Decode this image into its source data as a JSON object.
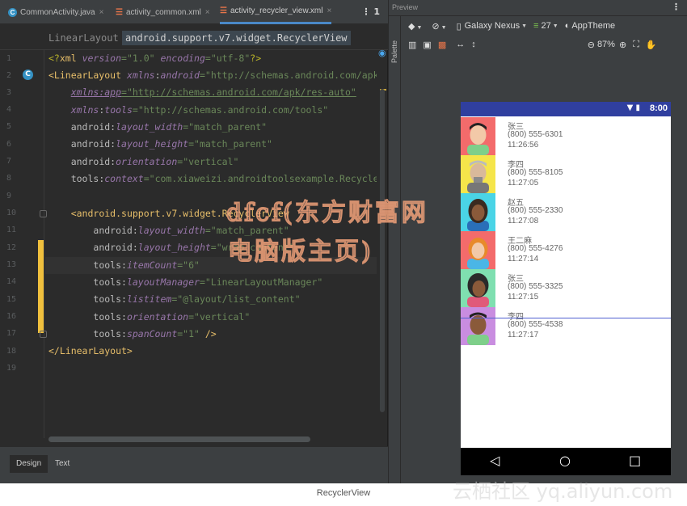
{
  "tabs": [
    {
      "label": "CommonActivity.java",
      "type": "java",
      "icon": "java-class-icon"
    },
    {
      "label": "activity_common.xml",
      "type": "xml",
      "icon": "layout-xml-icon"
    },
    {
      "label": "activity_recycler_view.xml",
      "type": "xml",
      "icon": "layout-xml-icon",
      "active": true
    }
  ],
  "tab_close_glyph": "×",
  "tab_menu_glyph": "⋮ 1",
  "breadcrumb": [
    "LinearLayout",
    "android.support.v7.widget.RecyclerView"
  ],
  "code": {
    "line_numbers": [
      "1",
      "2",
      "3",
      "4",
      "5",
      "6",
      "7",
      "8",
      "9",
      "10",
      "11",
      "12",
      "13",
      "14",
      "15",
      "16",
      "17",
      "18",
      "19"
    ]
  },
  "bottom_tabs": [
    "Design",
    "Text"
  ],
  "preview": {
    "title": "Preview",
    "palette_label": "Palette",
    "device": "Galaxy Nexus",
    "api": "27",
    "theme": "AppTheme",
    "zoom": "87%",
    "status_time": "8:00",
    "items": [
      {
        "name": "张三",
        "phone": "(800) 555-6301",
        "time": "11:26:56",
        "bg": "#f36b6b"
      },
      {
        "name": "李四",
        "phone": "(800) 555-8105",
        "time": "11:27:05",
        "bg": "#f5e54a"
      },
      {
        "name": "赵五",
        "phone": "(800) 555-2330",
        "time": "11:27:08",
        "bg": "#4ad4e6"
      },
      {
        "name": "王二麻",
        "phone": "(800) 555-4276",
        "time": "11:27:14",
        "bg": "#f36b6b"
      },
      {
        "name": "张三",
        "phone": "(800) 555-3325",
        "time": "11:27:15",
        "bg": "#7fdfb0"
      },
      {
        "name": "李四",
        "phone": "(800) 555-4538",
        "time": "11:27:17",
        "bg": "#c98de0"
      }
    ]
  },
  "watermark": {
    "line1": "dfcf(东方财富网",
    "line2": "电脑版主页)",
    "site": "云栖社区 yq.aliyun.com"
  },
  "caption": "RecyclerView"
}
